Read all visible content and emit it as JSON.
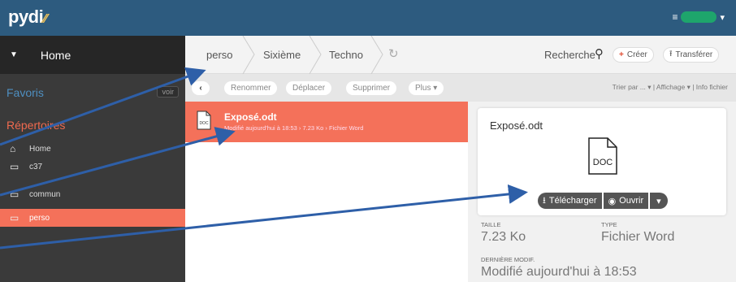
{
  "topbar": {
    "logo_text": "pydi",
    "user_menu_icon": "hamburger-icon",
    "accent": "#2d5b7f"
  },
  "sidebar": {
    "home_label": "Home",
    "favorites_title": "Favoris",
    "voir_label": "voir",
    "directories_title": "Répertoires",
    "items": [
      {
        "label": "Home",
        "icon": "home-icon"
      },
      {
        "label": "c37",
        "icon": "folder-icon"
      },
      {
        "label": "commun",
        "icon": "folder-icon"
      },
      {
        "label": "perso",
        "icon": "folder-icon",
        "active": true
      }
    ]
  },
  "breadcrumb": {
    "items": [
      "perso",
      "Sixième",
      "Techno"
    ],
    "search_label": "Recherche",
    "create_label": "Créer",
    "transfer_label": "Transférer"
  },
  "toolbar": {
    "rename_label": "Renommer",
    "move_label": "Déplacer",
    "delete_label": "Supprimer",
    "more_label": "Plus ▾",
    "right_text": "Trier par ... ▾ | Affichage ▾ | Info fichier"
  },
  "file": {
    "name": "Exposé.odt",
    "meta": "Modifié aujourd'hui à 18:53 › 7.23 Ko › Fichier Word",
    "icon_text": "DOC"
  },
  "detail": {
    "title": "Exposé.odt",
    "icon_text": "DOC",
    "download_label": "Télécharger",
    "open_label": "Ouvrir",
    "size_label": "TAILLE",
    "size_value": "7.23 Ko",
    "type_label": "TYPE",
    "type_value": "Fichier Word",
    "modified_label": "DERNIÈRE MODIF.",
    "modified_value": "Modifié aujourd'hui à 18:53"
  },
  "colors": {
    "accent_orange": "#f4715a",
    "arrow_blue": "#2e5fa8"
  }
}
